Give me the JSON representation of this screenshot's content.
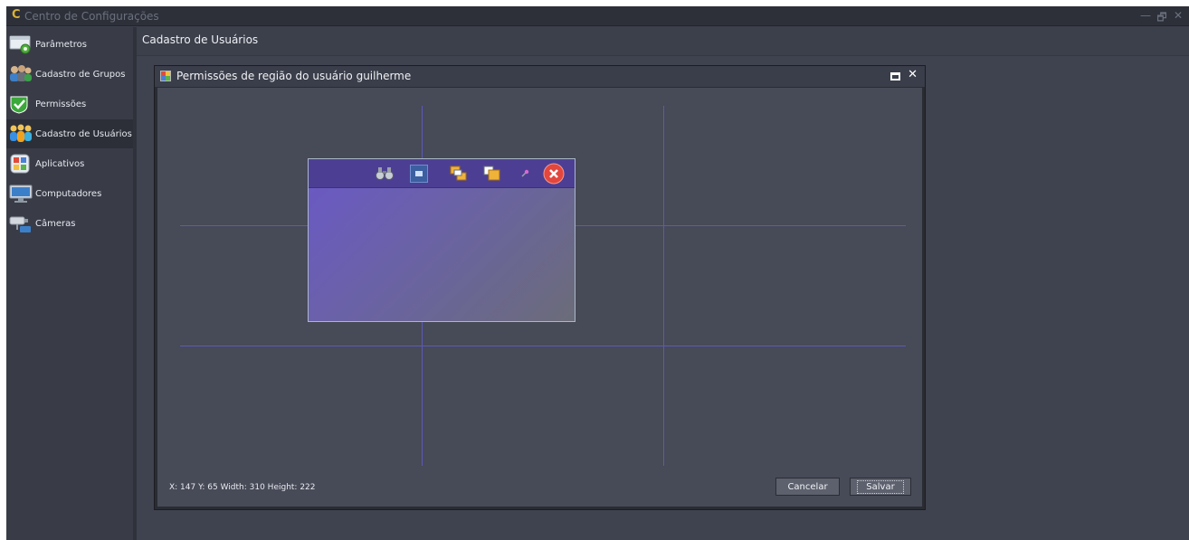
{
  "app": {
    "logo": "C",
    "title": "Centro de Configurações",
    "window_buttons": {
      "minimize": "—",
      "restore": "🗗",
      "close": "✕"
    }
  },
  "sidebar": {
    "items": [
      {
        "label": "Parâmetros",
        "icon": "parameters-icon",
        "active": false
      },
      {
        "label": "Cadastro de Grupos",
        "icon": "users-group-icon",
        "active": false
      },
      {
        "label": "Permissões",
        "icon": "check-shield-icon",
        "active": false
      },
      {
        "label": "Cadastro de Usuários",
        "icon": "users-icon",
        "active": true
      },
      {
        "label": "Aplicativos",
        "icon": "apps-icon",
        "active": false
      },
      {
        "label": "Computadores",
        "icon": "monitor-icon",
        "active": false
      },
      {
        "label": "Câmeras",
        "icon": "camera-icon",
        "active": false
      }
    ]
  },
  "main": {
    "title": "Cadastro de Usuários"
  },
  "dialog": {
    "title": "Permissões de região do usuário guilherme",
    "status": "X: 147  Y: 65  Width: 310  Height: 222",
    "cancel_label": "Cancelar",
    "save_label": "Salvar",
    "toolbar_icons": [
      "binoculars-icon",
      "select-region-icon",
      "bring-to-front-icon",
      "send-to-back-icon",
      "brush-icon",
      "close-circle-icon"
    ]
  },
  "colors": {
    "accent": "#d9b337",
    "guide": "#5b5ab8",
    "toolbar": "#4c3f93",
    "close_red": "#e2463c"
  }
}
